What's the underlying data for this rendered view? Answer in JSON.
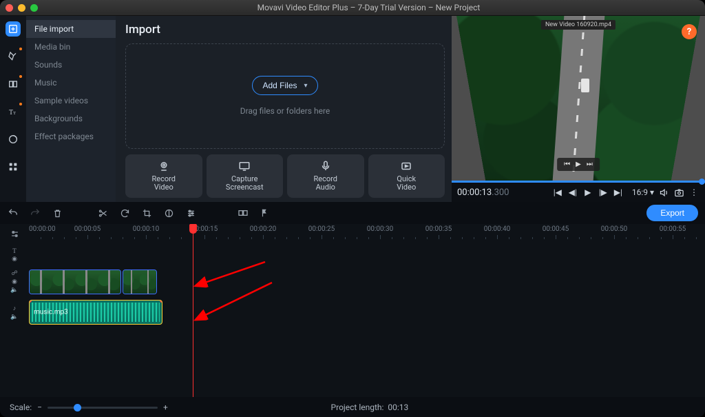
{
  "titlebar": {
    "title": "Movavi Video Editor Plus – 7-Day Trial Version – New Project"
  },
  "leftrail": [
    {
      "name": "import-icon",
      "sel": true,
      "dot": false
    },
    {
      "name": "filters-icon",
      "sel": false,
      "dot": true
    },
    {
      "name": "transitions-icon",
      "sel": false,
      "dot": true
    },
    {
      "name": "titles-icon",
      "sel": false,
      "dot": true
    },
    {
      "name": "stickers-icon",
      "sel": false,
      "dot": false
    },
    {
      "name": "more-icon",
      "sel": false,
      "dot": false
    }
  ],
  "sidelist": [
    {
      "label": "File import",
      "sel": true
    },
    {
      "label": "Media bin",
      "sel": false
    },
    {
      "label": "Sounds",
      "sel": false
    },
    {
      "label": "Music",
      "sel": false
    },
    {
      "label": "Sample videos",
      "sel": false
    },
    {
      "label": "Backgrounds",
      "sel": false
    },
    {
      "label": "Effect packages",
      "sel": false
    }
  ],
  "mainpanel": {
    "heading": "Import",
    "add_files": "Add Files",
    "drop_hint": "Drag files or folders here",
    "tiles": [
      {
        "name": "record-video",
        "label": "Record\nVideo"
      },
      {
        "name": "capture-screencast",
        "label": "Capture\nScreencast"
      },
      {
        "name": "record-audio",
        "label": "Record\nAudio"
      },
      {
        "name": "quick-video",
        "label": "Quick\nVideo"
      }
    ]
  },
  "preview": {
    "tab": "New Video 160920.mp4",
    "help": "?",
    "timecode": "00:00:13",
    "timecode_ms": ".300",
    "ratio": "16:9"
  },
  "midbar": {
    "export": "Export"
  },
  "ruler_start": "00:00:00",
  "ruler_labels": [
    "00:00:05",
    "00:00:10",
    "00:00:15",
    "00:00:20",
    "00:00:25",
    "00:00:30",
    "00:00:35",
    "00:00:40",
    "00:00:45",
    "00:00:50",
    "00:00:55"
  ],
  "audio_clip_label": "music.mp3",
  "bottom": {
    "scale_label": "Scale:",
    "project_len_label": "Project length:",
    "project_len": "00:13"
  }
}
